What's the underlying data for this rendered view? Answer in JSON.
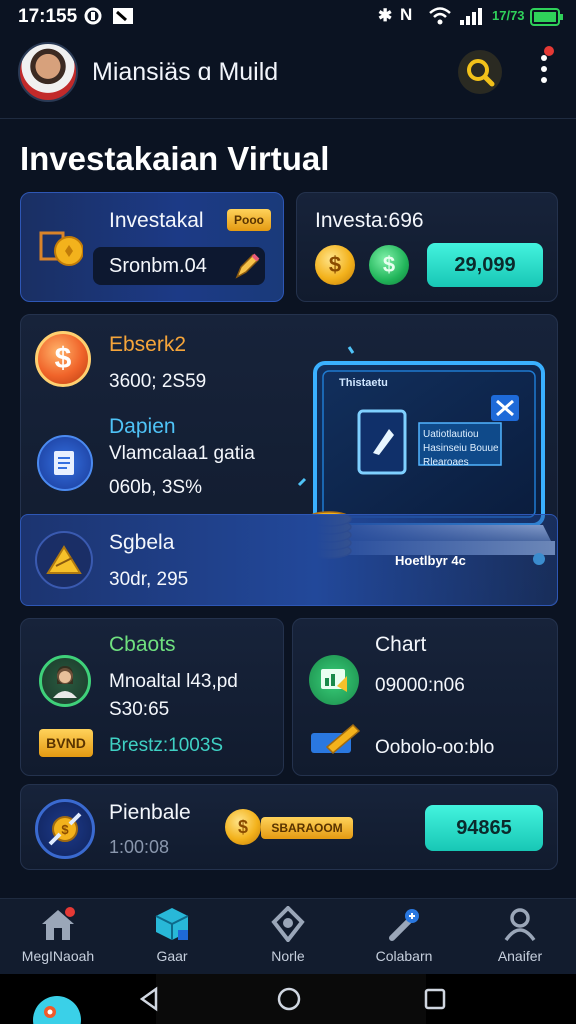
{
  "status_bar": {
    "time": "17:155",
    "battery_text": "17/73",
    "icons": [
      "p-icon",
      "notification-icon",
      "bluetooth-icon",
      "nfc-icon",
      "wifi-icon",
      "signal-icon",
      "battery-icon"
    ]
  },
  "header": {
    "user_name": "Miansiäs ɑ Muild"
  },
  "page": {
    "title": "Investakaian Virtual"
  },
  "card_invest": {
    "title": "Investakal",
    "badge": "Pooo",
    "value": "Sronbm.04"
  },
  "card_invest2": {
    "title": "Investa:696",
    "button": "29,099"
  },
  "feature": {
    "item1_title": "Ebserk2",
    "item1_value": "3600; 2S59",
    "item2_title": "Dapien",
    "item2_sub": "Vlamcalaa1 gatia",
    "item2_value": "060b, 3S%",
    "item3_title": "Sgbela",
    "item3_value": "30dr, 295",
    "screen_title": "Thistaetu",
    "screen_text_1": "Uatiotlautiou",
    "screen_text_2": "Hasinseiu Bouue",
    "screen_text_3": "Rlearoaes",
    "caption": "Hoetlbyr 4c"
  },
  "card_stats": {
    "title": "Cbaots",
    "line1": "Mnoaltal l43,pd",
    "line2": "S30:65",
    "badge": "BVND",
    "line3": "Brestz:1003S"
  },
  "card_chart": {
    "title": "Chart",
    "line1": "09000:n06",
    "line2": "Oobolo-oo:blo"
  },
  "card_bottom": {
    "title": "Pienbale",
    "sub": "1:00:08",
    "banner": "SBARAOOM",
    "button": "94865"
  },
  "nav": {
    "items": [
      {
        "label": "MegINaoah",
        "icon": "home-icon"
      },
      {
        "label": "Gaar",
        "icon": "cube-icon"
      },
      {
        "label": "Norle",
        "icon": "shield-icon"
      },
      {
        "label": "Colabarn",
        "icon": "tools-icon"
      },
      {
        "label": "Anaifer",
        "icon": "user-icon"
      }
    ]
  },
  "colors": {
    "background": "#0b1322",
    "accent_teal": "#22d3c0",
    "accent_gold": "#f3b21c",
    "accent_blue": "#1c3a86"
  }
}
